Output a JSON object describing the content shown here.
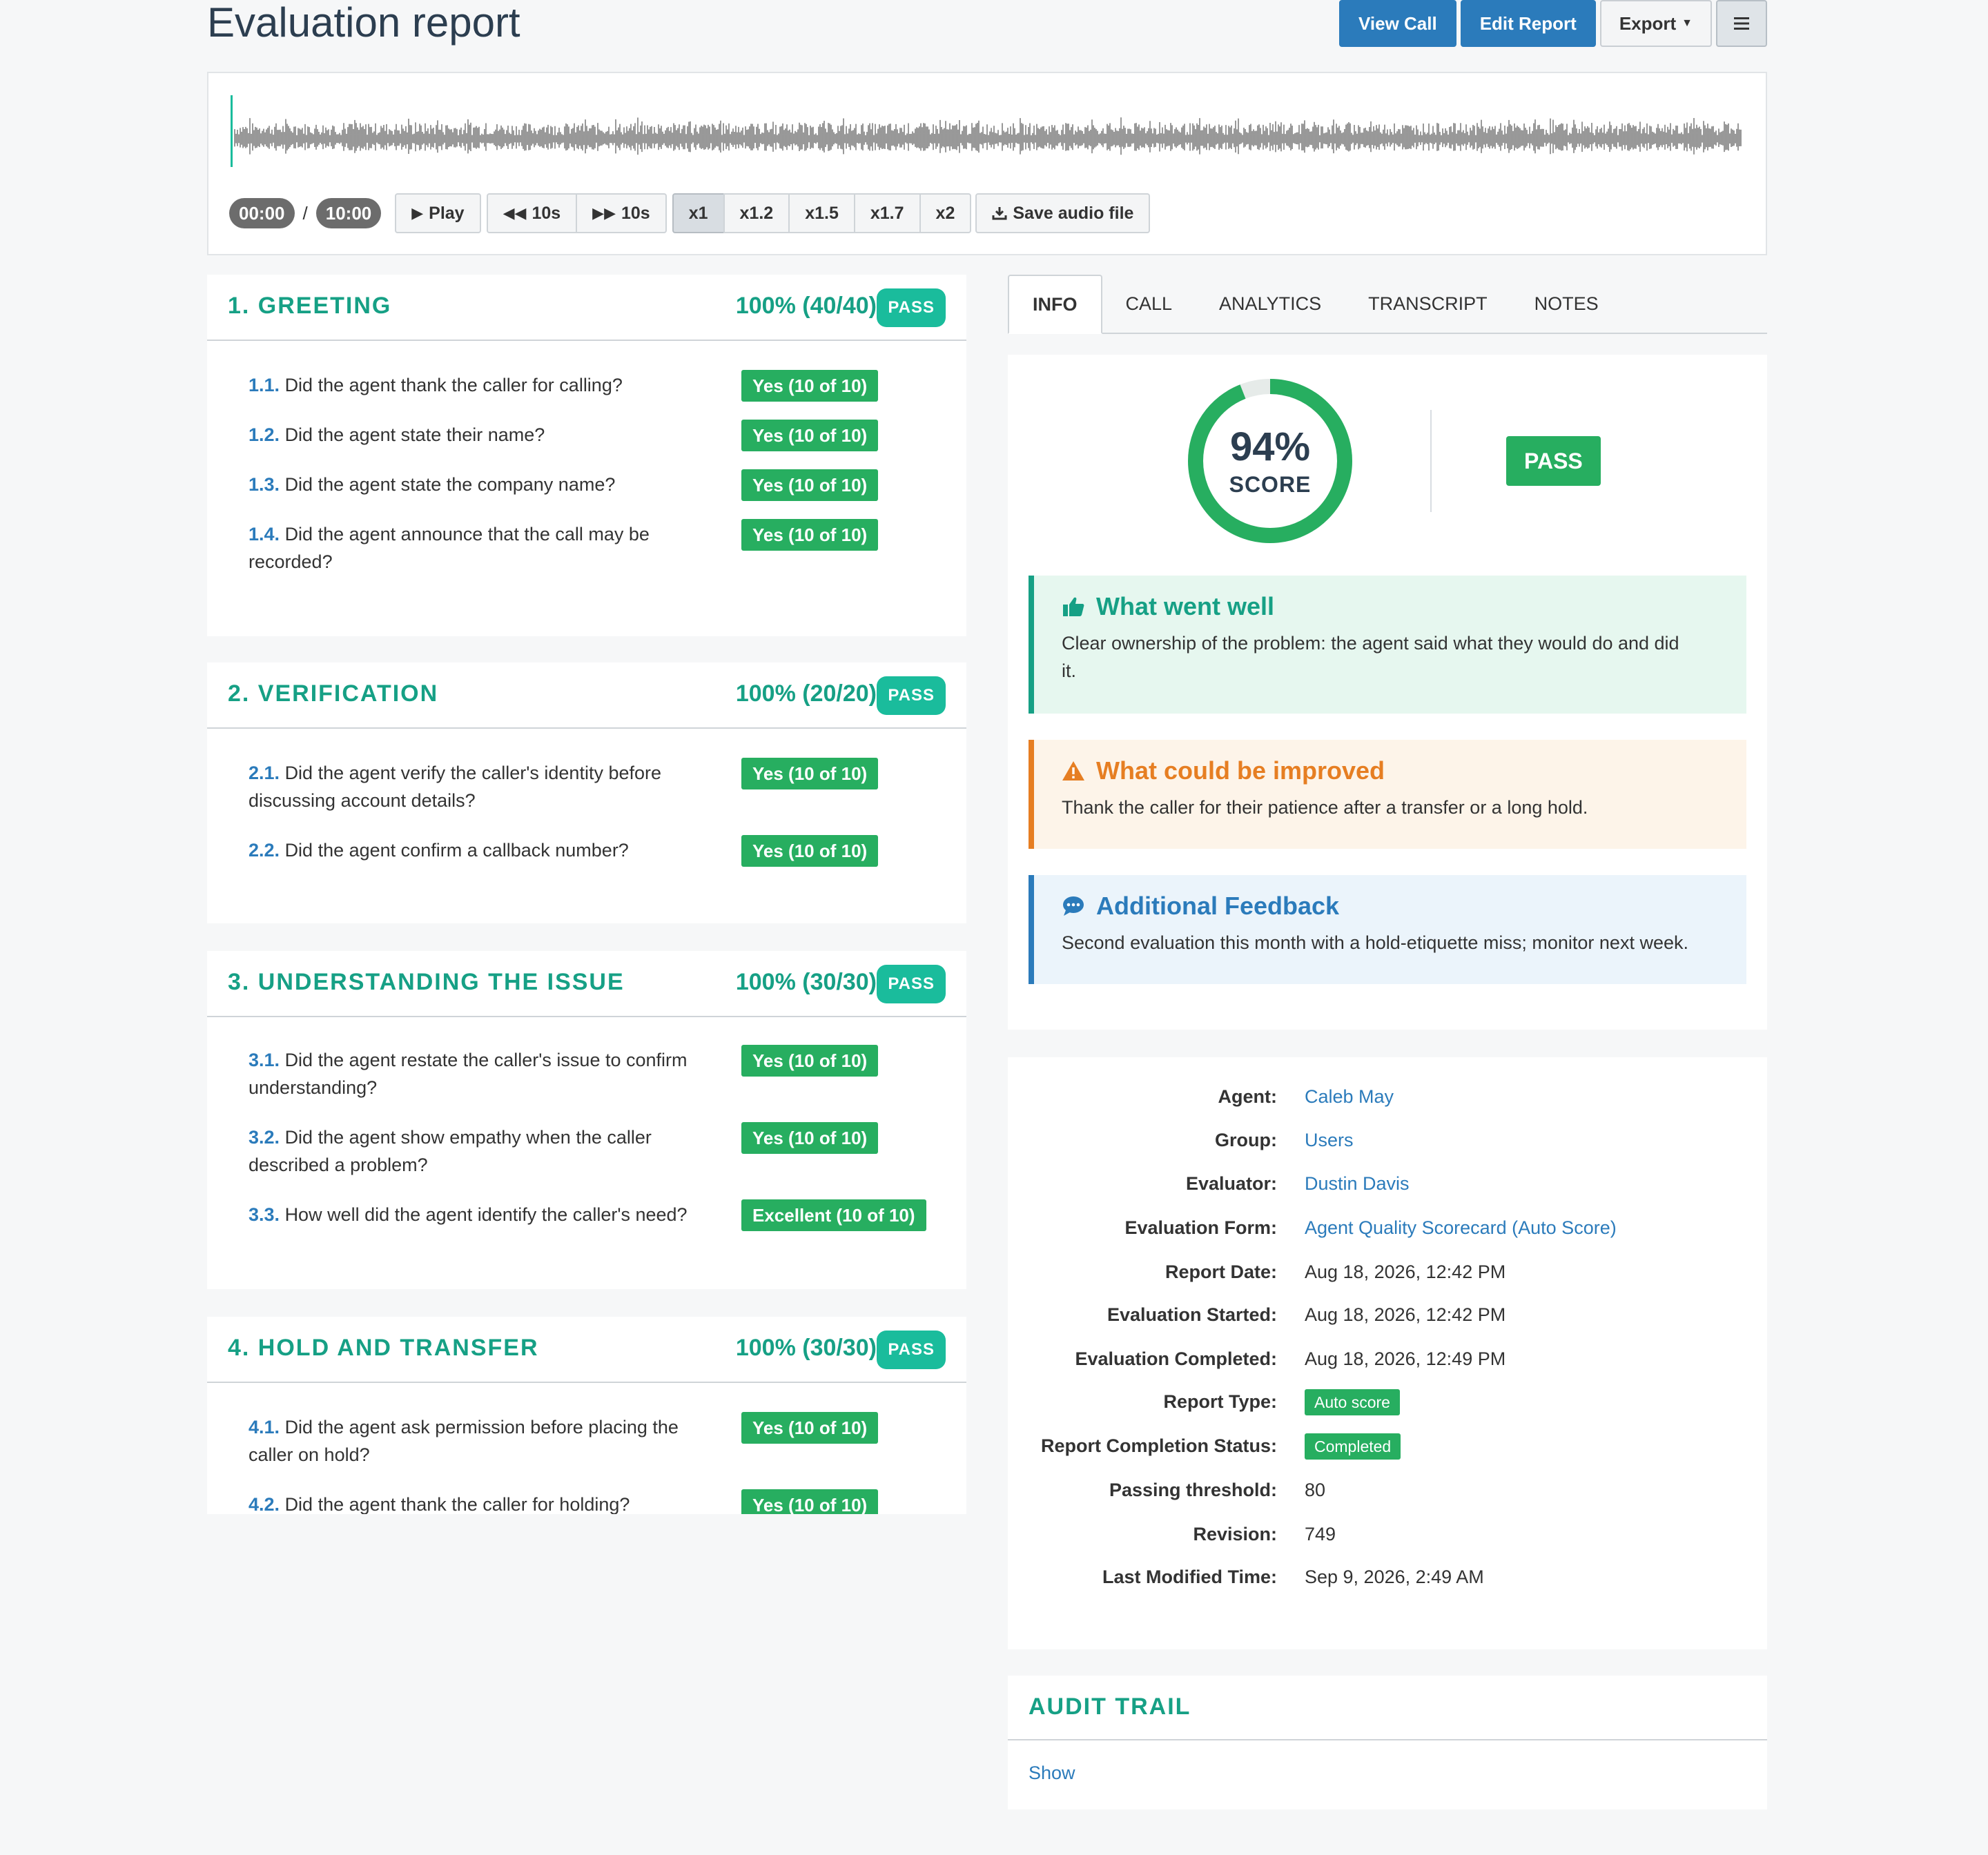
{
  "header": {
    "title": "Evaluation report",
    "view_call": "View Call",
    "edit_report": "Edit Report",
    "export": "Export"
  },
  "player": {
    "current_time": "00:00",
    "separator": "/",
    "duration": "10:00",
    "play": "Play",
    "back": "10s",
    "forward": "10s",
    "speeds": [
      "x1",
      "x1.2",
      "x1.5",
      "x1.7",
      "x2"
    ],
    "active_speed": "x1",
    "save": "Save audio file",
    "progress": 0
  },
  "sections": [
    {
      "title": "1. GREETING",
      "score": "100% (40/40)",
      "status": "PASS",
      "questions": [
        {
          "num": "1.1.",
          "text": "Did the agent thank the caller for calling?",
          "answer": "Yes (10 of 10)"
        },
        {
          "num": "1.2.",
          "text": "Did the agent state their name?",
          "answer": "Yes (10 of 10)"
        },
        {
          "num": "1.3.",
          "text": "Did the agent state the company name?",
          "answer": "Yes (10 of 10)"
        },
        {
          "num": "1.4.",
          "text": "Did the agent announce that the call may be recorded?",
          "answer": "Yes (10 of 10)"
        }
      ]
    },
    {
      "title": "2. VERIFICATION",
      "score": "100% (20/20)",
      "status": "PASS",
      "questions": [
        {
          "num": "2.1.",
          "text": "Did the agent verify the caller's identity before discussing account details?",
          "answer": "Yes (10 of 10)"
        },
        {
          "num": "2.2.",
          "text": "Did the agent confirm a callback number?",
          "answer": "Yes (10 of 10)"
        }
      ]
    },
    {
      "title": "3. UNDERSTANDING THE ISSUE",
      "score": "100% (30/30)",
      "status": "PASS",
      "questions": [
        {
          "num": "3.1.",
          "text": "Did the agent restate the caller's issue to confirm understanding?",
          "answer": "Yes (10 of 10)"
        },
        {
          "num": "3.2.",
          "text": "Did the agent show empathy when the caller described a problem?",
          "answer": "Yes (10 of 10)"
        },
        {
          "num": "3.3.",
          "text": "How well did the agent identify the caller's need?",
          "answer": "Excellent (10 of 10)"
        }
      ]
    },
    {
      "title": "4. HOLD AND TRANSFER",
      "score": "100% (30/30)",
      "status": "PASS",
      "questions": [
        {
          "num": "4.1.",
          "text": "Did the agent ask permission before placing the caller on hold?",
          "answer": "Yes (10 of 10)"
        },
        {
          "num": "4.2.",
          "text": "Did the agent thank the caller for holding?",
          "answer": "Yes (10 of 10)"
        }
      ]
    }
  ],
  "tabs": [
    "INFO",
    "CALL",
    "ANALYTICS",
    "TRANSCRIPT",
    "NOTES"
  ],
  "active_tab": "INFO",
  "score": {
    "value": "94%",
    "label": "SCORE",
    "fraction": 0.94,
    "status": "PASS"
  },
  "feedback": {
    "went_well_title": "What went well",
    "went_well_text": "Clear ownership of the problem: the agent said what they would do and did it.",
    "improve_title": "What could be improved",
    "improve_text": "Thank the caller for their patience after a transfer or a long hold.",
    "additional_title": "Additional Feedback",
    "additional_text": "Second evaluation this month with a hold-etiquette miss; monitor next week."
  },
  "meta": [
    {
      "label": "Agent:",
      "value": "Caleb May",
      "type": "link"
    },
    {
      "label": "Group:",
      "value": "Users",
      "type": "link"
    },
    {
      "label": "Evaluator:",
      "value": "Dustin Davis",
      "type": "link"
    },
    {
      "label": "Evaluation Form:",
      "value": "Agent Quality Scorecard (Auto Score)",
      "type": "link"
    },
    {
      "label": "Report Date:",
      "value": "Aug 18, 2026, 12:42 PM",
      "type": "text"
    },
    {
      "label": "Evaluation Started:",
      "value": "Aug 18, 2026, 12:42 PM",
      "type": "text"
    },
    {
      "label": "Evaluation Completed:",
      "value": "Aug 18, 2026, 12:49 PM",
      "type": "text"
    },
    {
      "label": "Report Type:",
      "value": "Auto score",
      "type": "badge"
    },
    {
      "label": "Report Completion Status:",
      "value": "Completed",
      "type": "badge"
    },
    {
      "label": "Passing threshold:",
      "value": "80",
      "type": "text"
    },
    {
      "label": "Revision:",
      "value": "749",
      "type": "text"
    },
    {
      "label": "Last Modified Time:",
      "value": "Sep 9, 2026, 2:49 AM",
      "type": "text"
    }
  ],
  "audit": {
    "title": "AUDIT TRAIL",
    "show": "Show"
  },
  "colors": {
    "accent_teal": "#16a085",
    "pass_green": "#27ae60",
    "primary_blue": "#2b7bbb",
    "warning_orange": "#e67e22"
  }
}
